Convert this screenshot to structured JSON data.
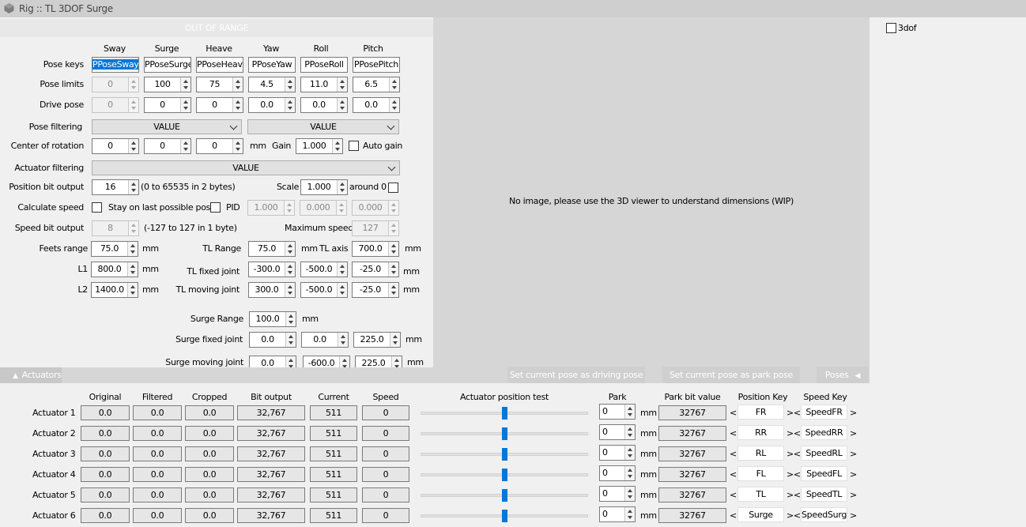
{
  "window": {
    "title": "Rig :: TL 3DOF Surge"
  },
  "out_of_range": "OUT OF RANGE",
  "columns": [
    "Sway",
    "Surge",
    "Heave",
    "Yaw",
    "Roll",
    "Pitch"
  ],
  "labels": {
    "pose_keys": "Pose keys",
    "pose_limits": "Pose limits",
    "drive_pose": "Drive pose",
    "pose_filtering": "Pose filtering",
    "center_of_rotation": "Center of rotation",
    "actuator_filtering": "Actuator filtering",
    "position_bit_output": "Position bit output",
    "calculate_speed": "Calculate speed",
    "speed_bit_output": "Speed bit output",
    "feets_range": "Feets range",
    "l1": "L1",
    "l2": "L2",
    "tl_range": "TL Range",
    "tl_axis": "TL axis",
    "tl_fixed_joint": "TL fixed joint",
    "tl_moving_joint": "TL moving joint",
    "surge_range": "Surge Range",
    "surge_fixed_joint": "Surge fixed joint",
    "surge_moving_joint": "Surge moving joint",
    "gain": "Gain",
    "auto_gain": "Auto gain",
    "scale": "Scale",
    "around_0": "around 0",
    "stay_on_last": "Stay on last possible pose",
    "pid": "PID",
    "maximum_speed": "Maximum speed",
    "mm": "mm",
    "pos_range_hint": "(0 to 65535 in 2 bytes)",
    "speed_range_hint": "(-127 to 127 in 1 byte)"
  },
  "pose_keys": [
    "PPoseSway",
    "PPoseSurge",
    "PPoseHeave",
    "PPoseYaw",
    "PPoseRoll",
    "PPosePitch"
  ],
  "pose_limits": [
    "0",
    "100",
    "75",
    "4.5",
    "11.0",
    "6.5"
  ],
  "drive_pose": [
    "0",
    "0",
    "0",
    "0.0",
    "0.0",
    "0.0"
  ],
  "pose_filtering": [
    "VALUE",
    "VALUE"
  ],
  "center_of_rotation": [
    "0",
    "0",
    "0"
  ],
  "gain": "1.000",
  "actuator_filtering": "VALUE",
  "position_bit_output": "16",
  "scale": "1.000",
  "pid": [
    "1.000",
    "0.000",
    "0.000"
  ],
  "speed_bit_output": "8",
  "maximum_speed": "127",
  "feets_range": "75.0",
  "l1": "800.0",
  "l2": "1400.0",
  "tl_range": "75.0",
  "tl_axis": "700.0",
  "tl_fixed_joint": [
    "-300.0",
    "-500.0",
    "-25.0"
  ],
  "tl_moving_joint": [
    "300.0",
    "-500.0",
    "-25.0"
  ],
  "surge_range": "100.0",
  "surge_fixed_joint": [
    "0.0",
    "0.0",
    "225.0"
  ],
  "surge_moving_joint": [
    "0.0",
    "-600.0",
    "225.0"
  ],
  "image_placeholder": "No image, please use the 3D viewer to understand dimensions (WIP)",
  "dof_checkbox": "3dof",
  "buttons": {
    "set_driving": "Set current pose as driving pose",
    "set_park": "Set current pose as park pose",
    "poses": "Poses"
  },
  "actuators_tab": "Actuators",
  "act_headers": {
    "original": "Original",
    "filtered": "Filtered",
    "cropped": "Cropped",
    "bit_output": "Bit output",
    "current": "Current",
    "speed": "Speed",
    "position_test": "Actuator position test",
    "park": "Park",
    "park_bit": "Park bit value",
    "position_key": "Position Key",
    "speed_key": "Speed Key"
  },
  "actuators": [
    {
      "name": "Actuator 1",
      "original": "0.0",
      "filtered": "0.0",
      "cropped": "0.0",
      "bit": "32,767",
      "current": "511",
      "speed": "0",
      "position": 0.5,
      "park": "0",
      "park_bit": "32767",
      "pos_key": "FR",
      "speed_key": "SpeedFR"
    },
    {
      "name": "Actuator 2",
      "original": "0.0",
      "filtered": "0.0",
      "cropped": "0.0",
      "bit": "32,767",
      "current": "511",
      "speed": "0",
      "position": 0.5,
      "park": "0",
      "park_bit": "32767",
      "pos_key": "RR",
      "speed_key": "SpeedRR"
    },
    {
      "name": "Actuator 3",
      "original": "0.0",
      "filtered": "0.0",
      "cropped": "0.0",
      "bit": "32,767",
      "current": "511",
      "speed": "0",
      "position": 0.5,
      "park": "0",
      "park_bit": "32767",
      "pos_key": "RL",
      "speed_key": "SpeedRL"
    },
    {
      "name": "Actuator 4",
      "original": "0.0",
      "filtered": "0.0",
      "cropped": "0.0",
      "bit": "32,767",
      "current": "511",
      "speed": "0",
      "position": 0.5,
      "park": "0",
      "park_bit": "32767",
      "pos_key": "FL",
      "speed_key": "SpeedFL"
    },
    {
      "name": "Actuator 5",
      "original": "0.0",
      "filtered": "0.0",
      "cropped": "0.0",
      "bit": "32,767",
      "current": "511",
      "speed": "0",
      "position": 0.5,
      "park": "0",
      "park_bit": "32767",
      "pos_key": "TL",
      "speed_key": "SpeedTL"
    },
    {
      "name": "Actuator 6",
      "original": "0.0",
      "filtered": "0.0",
      "cropped": "0.0",
      "bit": "32,767",
      "current": "511",
      "speed": "0",
      "position": 0.5,
      "park": "0",
      "park_bit": "32767",
      "pos_key": "Surge",
      "speed_key": "SpeedSurge"
    }
  ],
  "bracket_left": "<",
  "bracket_mid": "><",
  "bracket_right": ">",
  "colors": {
    "accent": "#0078d7",
    "panel": "#f0f0f0",
    "frame": "#cfcfcf"
  }
}
